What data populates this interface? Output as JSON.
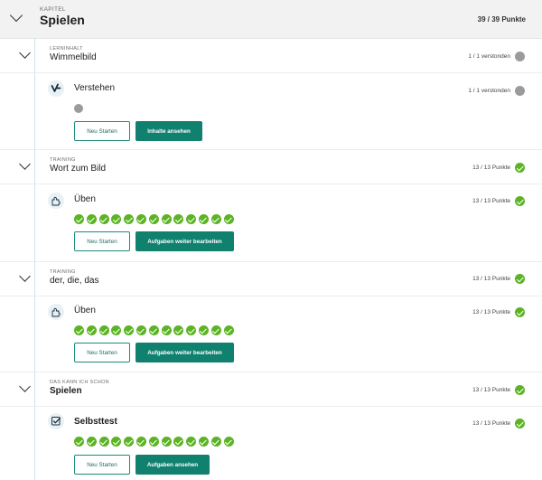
{
  "chapter": {
    "kicker": "KAPITEL",
    "title": "Spielen",
    "points": "39 / 39 Punkte"
  },
  "units": [
    {
      "kicker": "LERNINHALT",
      "title": "Wimmelbild",
      "status": "1 / 1 verstonden",
      "activity": {
        "title": "Verstehen",
        "status": "1 / 1 verstonden",
        "icon": "understand-icon",
        "btn_outline": "Neu Starten",
        "btn_solid": "Inhalte ansehen"
      }
    },
    {
      "kicker": "TRAINING",
      "title": "Wort zum Bild",
      "status": "13 / 13 Punkte",
      "activity": {
        "title": "Üben",
        "status": "13 / 13 Punkte",
        "icon": "puzzle-icon",
        "btn_outline": "Neu Starten",
        "btn_solid": "Aufgaben weiter bearbeiten"
      }
    },
    {
      "kicker": "TRAINING",
      "title": "der, die, das",
      "status": "13 / 13 Punkte",
      "activity": {
        "title": "Üben",
        "status": "13 / 13 Punkte",
        "icon": "puzzle-icon",
        "btn_outline": "Neu Starten",
        "btn_solid": "Aufgaben weiter bearbeiten"
      }
    },
    {
      "kicker": "DAS KANN ICH SCHON",
      "title": "Spielen",
      "status": "13 / 13 Punkte",
      "activity": {
        "title": "Selbsttest",
        "status": "13 / 13 Punkte",
        "icon": "checkbox-icon",
        "btn_outline": "Neu Starten",
        "btn_solid": "Aufgaben ansehen"
      }
    }
  ],
  "colors": {
    "accent": "#10806f",
    "success": "#5cb324",
    "neutral": "#9b9b9b"
  }
}
